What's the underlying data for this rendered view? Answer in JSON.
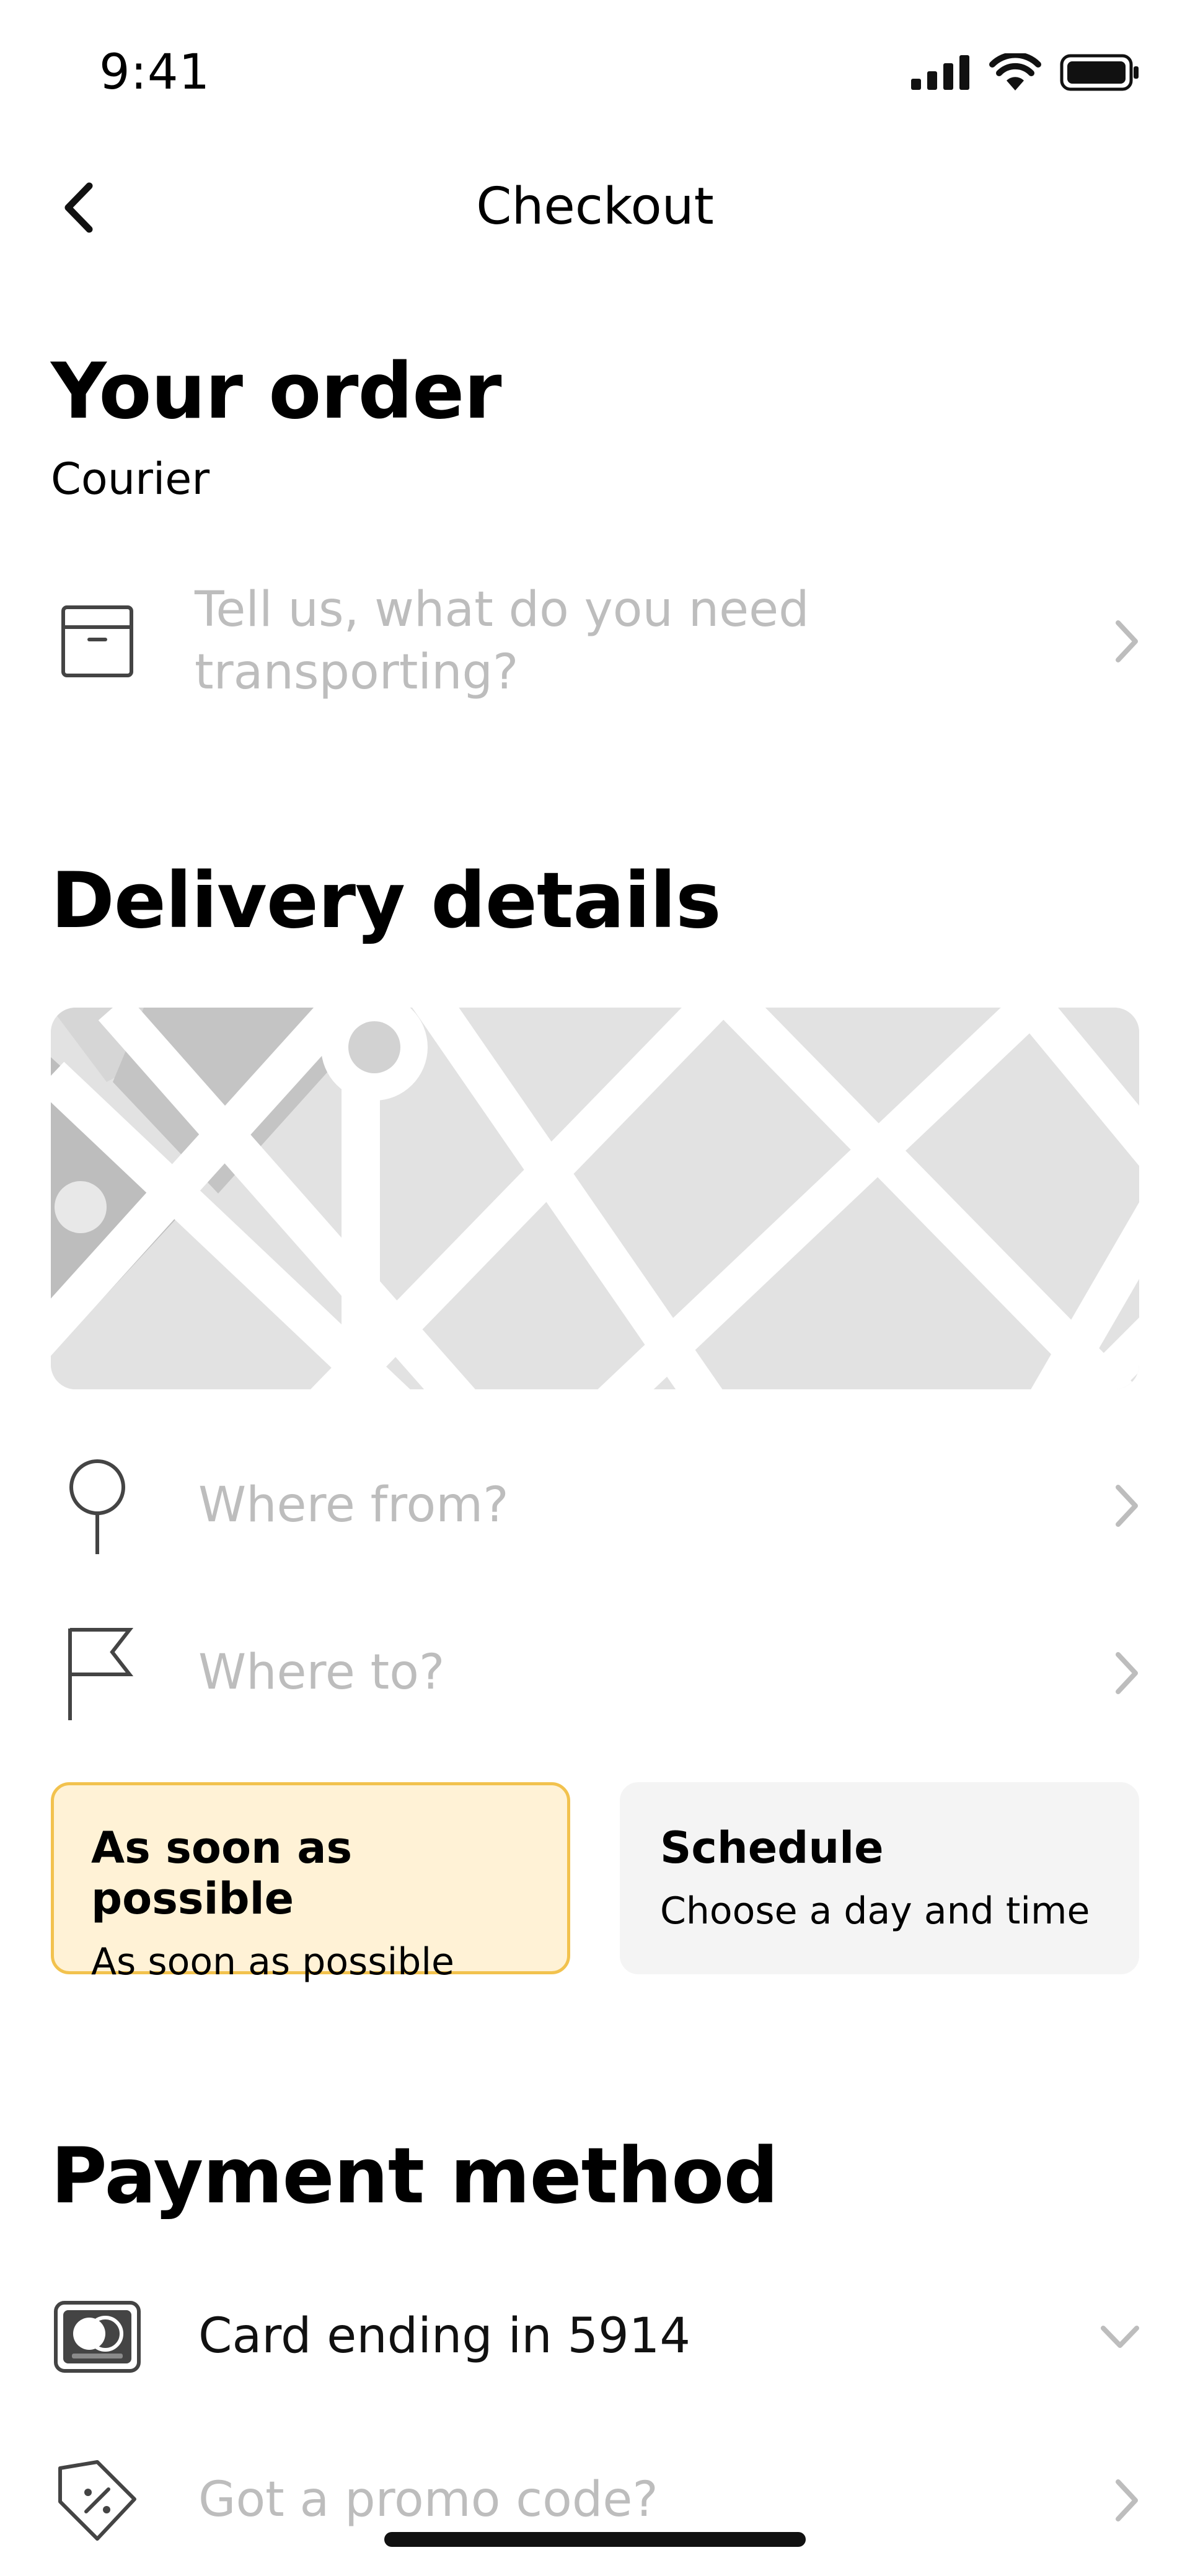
{
  "status_bar": {
    "time": "9:41"
  },
  "nav": {
    "title": "Checkout"
  },
  "order": {
    "heading": "Your order",
    "service": "Courier",
    "item_placeholder": "Tell us, what do you need transporting?"
  },
  "delivery": {
    "heading": "Delivery details",
    "from_placeholder": "Where from?",
    "to_placeholder": "Where to?",
    "options": [
      {
        "title": "As soon as possible",
        "subtitle": "As soon as possible",
        "selected": true
      },
      {
        "title": "Schedule",
        "subtitle": "Choose a day and time",
        "selected": false
      }
    ]
  },
  "payment": {
    "heading": "Payment method",
    "card_label": "Card ending in 5914",
    "card_brand": "mastercard",
    "promo_placeholder": "Got a promo code?"
  },
  "colors": {
    "accent_border": "#f2c24e",
    "accent_fill": "#fff2d6",
    "placeholder_text": "#bdbdbd",
    "map_block": "#e2e2e2"
  },
  "icons": [
    "chevron-left-icon",
    "box-icon",
    "chevron-right-icon",
    "pin-icon",
    "flag-icon",
    "mastercard-icon",
    "chevron-down-icon",
    "promo-tag-icon",
    "signal-icon",
    "wifi-icon",
    "battery-icon"
  ]
}
